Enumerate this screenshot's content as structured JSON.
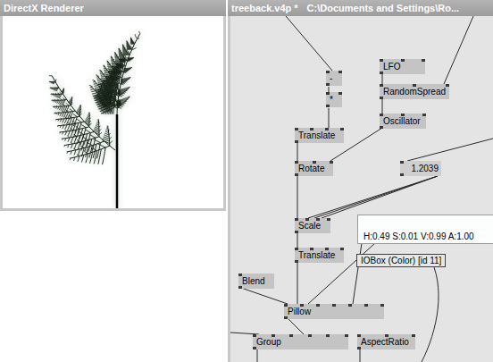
{
  "renderer": {
    "title": "DirectX Renderer"
  },
  "patch": {
    "title": "treeback.v4p *",
    "path": "C:\\Documents and Settings\\Ro..."
  },
  "nodes": [
    {
      "label": "-"
    },
    {
      "label": "*"
    },
    {
      "label": "LFO"
    },
    {
      "label": "RandomSpread"
    },
    {
      "label": "Oscillator"
    },
    {
      "label": "Translate"
    },
    {
      "label": "Rotate"
    },
    {
      "label": "1.2039"
    },
    {
      "label": "Scale"
    },
    {
      "label": "Translate"
    },
    {
      "label": "Blend"
    },
    {
      "label": "Pillow"
    },
    {
      "label": "Group"
    },
    {
      "label": "AspectRatio"
    }
  ],
  "color_box": {
    "reading": "H:0.49 S:0.01 V:0.99 A:1.00",
    "color": "#fcfdfd"
  },
  "tooltip": "IOBox (Color) [id 11]"
}
